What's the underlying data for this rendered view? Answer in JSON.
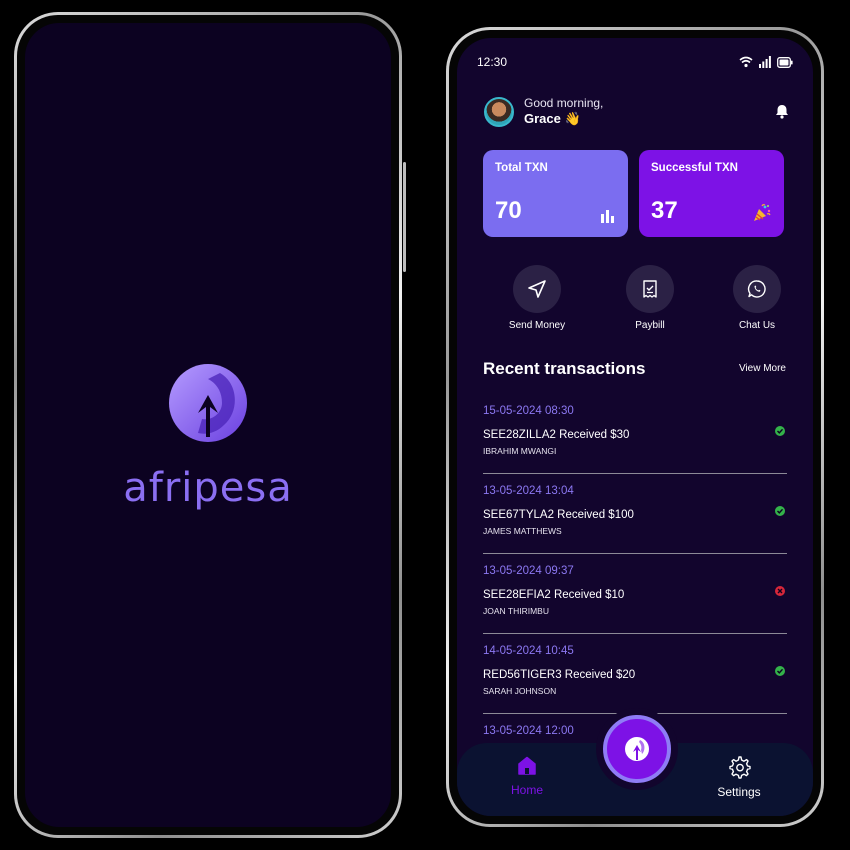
{
  "splash": {
    "brand_name": "afripesa"
  },
  "status_bar": {
    "time": "12:30"
  },
  "header": {
    "greeting": "Good morning,",
    "user_name": "Grace 👋"
  },
  "stats": {
    "total": {
      "label": "Total TXN",
      "value": "70"
    },
    "success": {
      "label": "Successful TXN",
      "value": "37"
    }
  },
  "actions": [
    {
      "label": "Send Money",
      "icon": "send-icon"
    },
    {
      "label": "Paybill",
      "icon": "receipt-icon"
    },
    {
      "label": "Chat Us",
      "icon": "whatsapp-icon"
    }
  ],
  "recent": {
    "title": "Recent transactions",
    "view_more": "View More",
    "items": [
      {
        "date": "15-05-2024 08:30",
        "title": "SEE28ZILLA2 Received $30",
        "name": "IBRAHIM MWANGI",
        "status": "success"
      },
      {
        "date": "13-05-2024 13:04",
        "title": "SEE67TYLA2 Received $100",
        "name": "JAMES MATTHEWS",
        "status": "success"
      },
      {
        "date": "13-05-2024 09:37",
        "title": "SEE28EFIA2 Received $10",
        "name": "JOAN THIRIMBU",
        "status": "failed"
      },
      {
        "date": "14-05-2024 10:45",
        "title": "RED56TIGER3 Received $20",
        "name": "SARAH JOHNSON",
        "status": "success"
      },
      {
        "date": "13-05-2024 12:00",
        "title": "",
        "name": "",
        "status": "success"
      }
    ]
  },
  "bottom_nav": {
    "home": "Home",
    "settings": "Settings"
  },
  "colors": {
    "background": "#12052d",
    "accent": "#7d12e6",
    "accent_light": "#7b6df0",
    "date_text": "#8c78f2",
    "success": "#34b34a",
    "failed": "#d6273a"
  }
}
